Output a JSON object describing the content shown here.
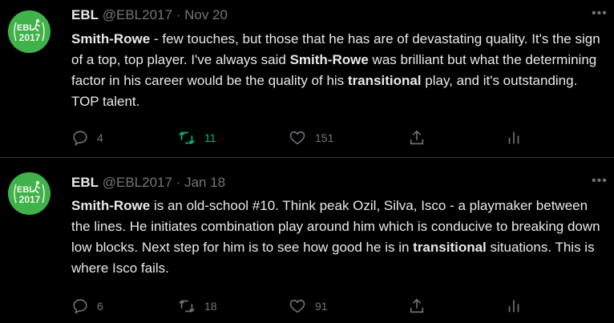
{
  "tweets": [
    {
      "author_name": "EBL",
      "handle": "@EBL2017",
      "separator": "·",
      "date": "Nov 20",
      "avatar_text": [
        "EBL",
        "2017"
      ],
      "text": [
        {
          "t": "Smith-Rowe",
          "b": true
        },
        {
          "t": " - few touches, but those that he has are of devastating quality. It's the sign of a top, top player. I've always said ",
          "b": false
        },
        {
          "t": "Smith-Rowe",
          "b": true
        },
        {
          "t": " was brilliant but what the determining factor in his career would be the quality of his ",
          "b": false
        },
        {
          "t": "transitional",
          "b": true
        },
        {
          "t": " play, and it's outstanding. TOP talent.",
          "b": false
        }
      ],
      "replies": "4",
      "retweets": "11",
      "likes": "151"
    },
    {
      "author_name": "EBL",
      "handle": "@EBL2017",
      "separator": "·",
      "date": "Jan 18",
      "avatar_text": [
        "EBL",
        "2017"
      ],
      "text": [
        {
          "t": "Smith-Rowe",
          "b": true
        },
        {
          "t": " is an old-school #10. Think peak Ozil, Silva, Isco - a playmaker between the lines. He initiates combination play around him which is conducive to breaking down low blocks. Next step for him is to see how good he is in ",
          "b": false
        },
        {
          "t": "transitional",
          "b": true
        },
        {
          "t": " situations. This is where Isco fails.",
          "b": false
        }
      ],
      "replies": "6",
      "retweets": "18",
      "likes": "91"
    }
  ],
  "colors": {
    "background": "#000000",
    "text": "#e7e9ea",
    "muted": "#71767b",
    "retweet_active": "#00ba7c",
    "avatar_bg": "#3fb24a",
    "divider": "#2f3336"
  }
}
